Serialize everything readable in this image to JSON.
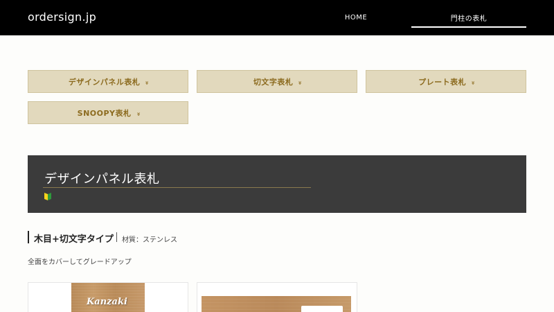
{
  "header": {
    "logo": "ordersign.jp",
    "nav": [
      {
        "label": "HOME"
      },
      {
        "label": "門柱の表札",
        "active": true
      }
    ]
  },
  "categories": [
    {
      "label": "デザインパネル表札"
    },
    {
      "label": "切文字表札"
    },
    {
      "label": "プレート表札"
    },
    {
      "label": "SNOOPY表札"
    }
  ],
  "category_chevron": "»",
  "panel": {
    "title": "デザインパネル表札",
    "icon": "beginner-mark-icon"
  },
  "section": {
    "title": "木目+切文字タイプ",
    "material": "材質：ステンレス",
    "description": "全面をカバーしてグレードアップ"
  },
  "products": [
    {
      "name_on_sign": "Kanzaki"
    },
    {}
  ],
  "colors": {
    "header_bg": "#000000",
    "category_bg": "#e2d9bd",
    "category_text": "#8c6b1f",
    "panel_bg": "#3b3b3b"
  }
}
